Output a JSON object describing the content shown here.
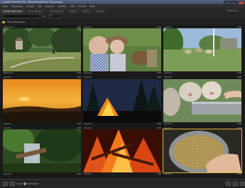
{
  "window": {
    "title": "Adobe Premiere Pro - [Documents\\Ohne Titel.prproj]",
    "icon": "premiere-app-icon"
  },
  "menu": [
    "Datei",
    "Bearbeiten",
    "Projekt",
    "Clip",
    "Sequenz",
    "Grafiken",
    "Titel",
    "Fenster",
    "Hilfe"
  ],
  "tabs": [
    {
      "label": "Projekt: Ohne Titel",
      "active": true
    },
    {
      "label": "Media-Browser",
      "active": false
    },
    {
      "label": "Informationen",
      "active": false
    },
    {
      "label": "Effekte",
      "active": false
    },
    {
      "label": "Marker",
      "active": false
    },
    {
      "label": "Verlauf",
      "active": false
    }
  ],
  "item_count": "10 Elemente",
  "toolbar": {
    "search_placeholder": "",
    "in_label": "In:",
    "in_value": "Alle"
  },
  "folder": {
    "label": "Ohne Titel.prproj"
  },
  "clips": [
    {
      "name": "Wiese.mov",
      "dur": "0;00",
      "scene": "meadow"
    },
    {
      "name": "clip.mov",
      "dur": "0;00",
      "scene": "girl"
    },
    {
      "name": "clip.mov",
      "dur": "0;00",
      "scene": "goats"
    },
    {
      "name": "clip.mov",
      "dur": "0;00",
      "scene": "sunset"
    },
    {
      "name": "clip.mov",
      "dur": "0;00",
      "scene": "fire-night"
    },
    {
      "name": "clip.mov",
      "dur": "0;00",
      "scene": "sheep"
    },
    {
      "name": "clip.mov",
      "dur": "0;00",
      "scene": "forest"
    },
    {
      "name": "clip.mov",
      "dur": "0;00",
      "scene": "flames"
    },
    {
      "name": "clip.mov",
      "dur": "0;00",
      "scene": "bucket"
    }
  ],
  "colors": {
    "selection": "#e0b13a",
    "panel": "#1b1b1b"
  }
}
